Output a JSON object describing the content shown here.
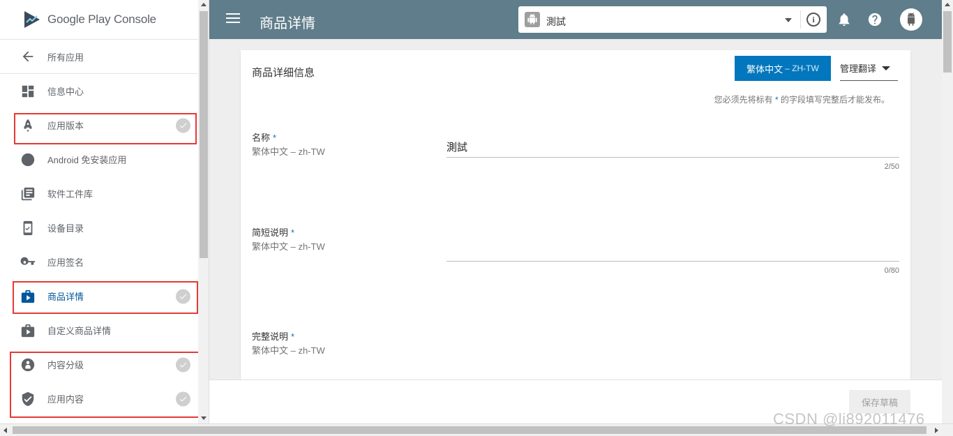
{
  "brand": {
    "google": "Google",
    "play": "Play",
    "console": "Console"
  },
  "sidebar": {
    "back_label": "所有应用",
    "items": [
      {
        "label": "信息中心",
        "icon": "dashboard-icon",
        "checked": false
      },
      {
        "label": "应用版本",
        "icon": "rocket-icon",
        "checked": true
      },
      {
        "label": "Android 免安装应用",
        "icon": "instant-app-icon",
        "checked": false
      },
      {
        "label": "软件工件库",
        "icon": "library-icon",
        "checked": false
      },
      {
        "label": "设备目录",
        "icon": "device-catalog-icon",
        "checked": false
      },
      {
        "label": "应用签名",
        "icon": "key-icon",
        "checked": false
      },
      {
        "label": "商品详情",
        "icon": "store-listing-icon",
        "checked": true,
        "active": true
      },
      {
        "label": "自定义商品详情",
        "icon": "custom-listing-icon",
        "checked": false
      },
      {
        "label": "内容分级",
        "icon": "content-rating-icon",
        "checked": true
      },
      {
        "label": "应用内容",
        "icon": "shield-icon",
        "checked": true
      }
    ]
  },
  "topbar": {
    "title": "商品详情",
    "app_name": "測試"
  },
  "card": {
    "title": "商品详细信息",
    "language_button": "繁体中文",
    "language_code": "– ZH-TW",
    "manage_translations": "管理翻译",
    "required_note_prefix": "您必须先将标有",
    "required_star": "*",
    "required_note_suffix": "的字段填写完整后才能发布。",
    "fields": [
      {
        "label": "名称",
        "sub": "繁体中文 – zh-TW",
        "value": "測試",
        "count": "2/50"
      },
      {
        "label": "简短说明",
        "sub": "繁体中文 – zh-TW",
        "value": "",
        "count": "0/80"
      },
      {
        "label": "完整说明",
        "sub": "繁体中文 – zh-TW",
        "value": "",
        "count": ""
      }
    ]
  },
  "footer": {
    "save_label": "保存草稿"
  },
  "watermark": "CSDN @li892011476",
  "colors": {
    "topbar": "#607d8b",
    "accent": "#0277bd",
    "active_nav": "#01579b",
    "highlight": "#e53935"
  }
}
